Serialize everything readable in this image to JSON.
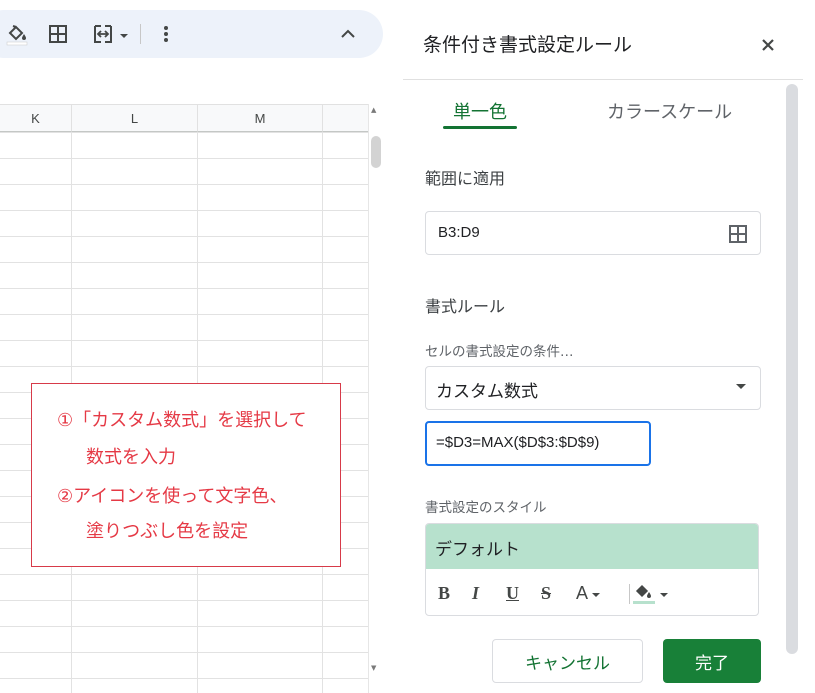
{
  "toolbar": {
    "icons": [
      "fill-color-icon",
      "borders-icon",
      "merge-cells-icon",
      "more-vert-icon",
      "collapse-icon"
    ]
  },
  "sheet": {
    "columns": [
      "K",
      "L",
      "M"
    ]
  },
  "annotation": {
    "lines": [
      "①「カスタム数式」を選択して",
      "数式を入力",
      "②アイコンを使って文字色、",
      "塗りつぶし色を設定"
    ],
    "color": "#e53945"
  },
  "panel": {
    "title": "条件付き書式設定ルール",
    "tabs": [
      {
        "label": "単一色",
        "active": true
      },
      {
        "label": "カラースケール",
        "active": false
      }
    ],
    "range_label": "範囲に適用",
    "range_value": "B3:D9",
    "rules_label": "書式ルール",
    "condition_label": "セルの書式設定の条件…",
    "condition_value": "カスタム数式",
    "formula_value": "=$D3=MAX($D$3:$D$9)",
    "style_label": "書式設定のスタイル",
    "style_preview": "デフォルト",
    "style_preview_color": "#b7e1cd",
    "format_buttons": [
      "B",
      "I",
      "U",
      "S",
      "A"
    ],
    "cancel_label": "キャンセル",
    "done_label": "完了",
    "accent_color": "#137333"
  }
}
